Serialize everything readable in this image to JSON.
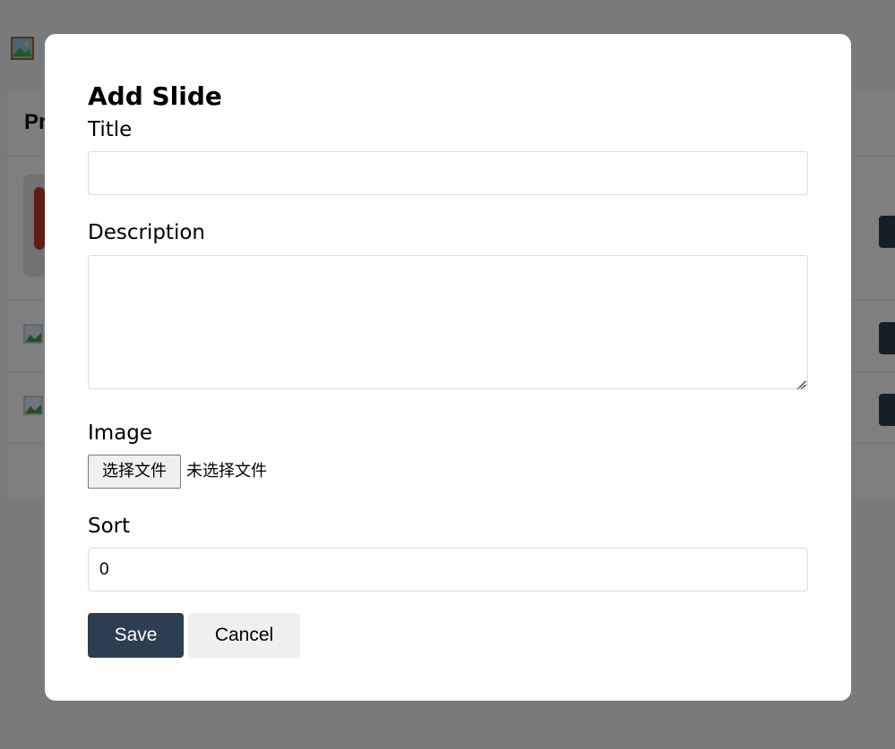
{
  "background": {
    "panel_title": "Pr"
  },
  "modal": {
    "title": "Add Slide",
    "fields": {
      "title": {
        "label": "Title",
        "value": "",
        "placeholder": ""
      },
      "description": {
        "label": "Description",
        "value": "",
        "placeholder": ""
      },
      "image": {
        "label": "Image",
        "button_label": "选择文件",
        "status": "未选择文件"
      },
      "sort": {
        "label": "Sort",
        "value": "0"
      }
    },
    "buttons": {
      "save": "Save",
      "cancel": "Cancel"
    }
  },
  "colors": {
    "primary": "#2c3e50",
    "secondary": "#efefef",
    "overlay": "rgba(0,0,0,0.5)"
  },
  "icons": [
    "image-icon",
    "broken-image-icon",
    "resize-grip-icon"
  ]
}
